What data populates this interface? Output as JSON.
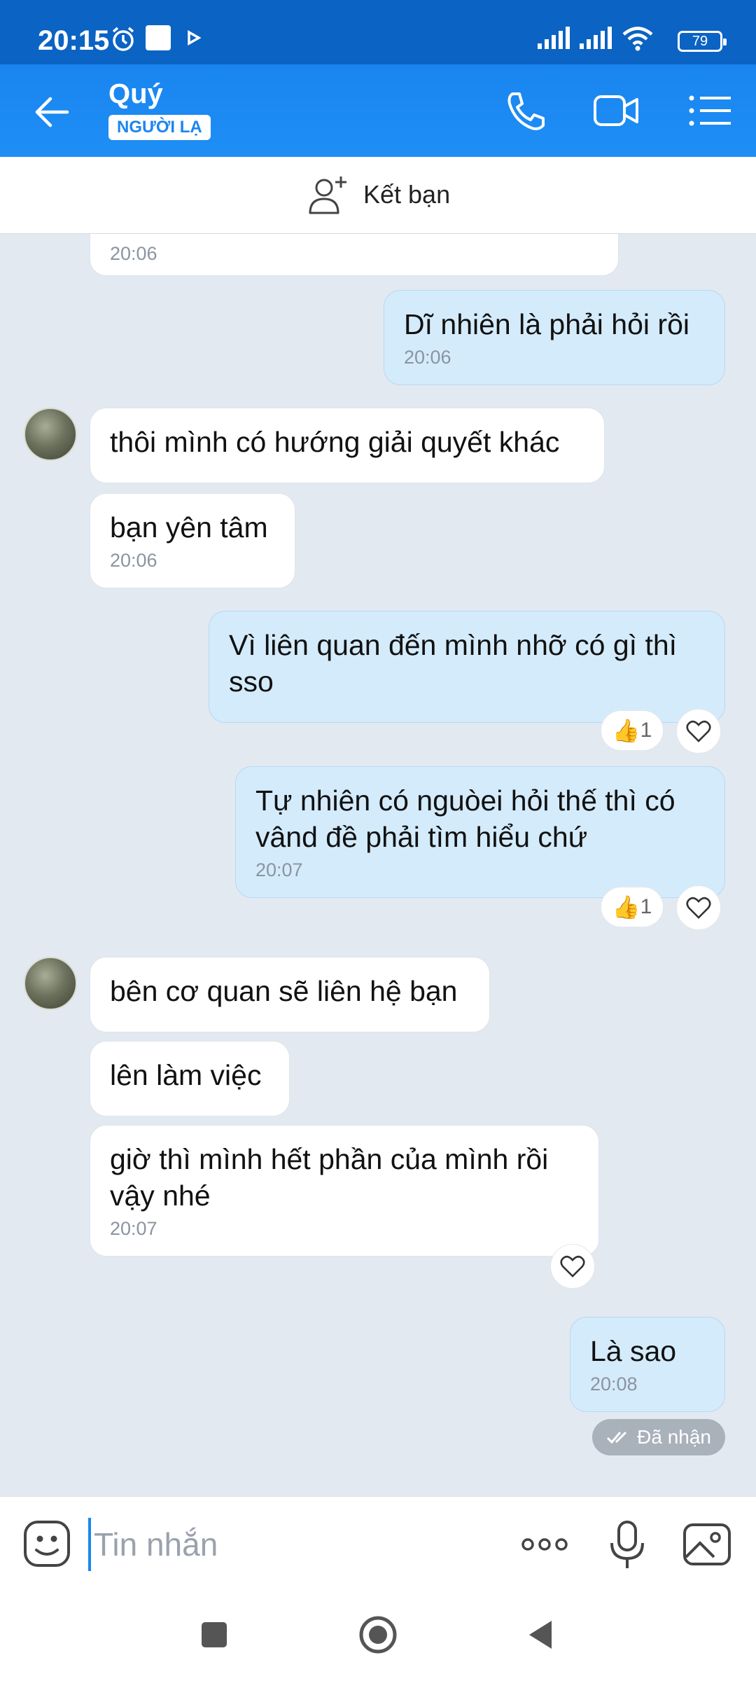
{
  "status": {
    "time": "20:15",
    "battery": "79"
  },
  "header": {
    "name": "Quý",
    "badge": "NGƯỜI LẠ"
  },
  "add_friend": {
    "label": "Kết bạn"
  },
  "messages": {
    "m0_time": "20:06",
    "m1_text": "Dĩ nhiên là phải hỏi rồi",
    "m1_time": "20:06",
    "m2_text": "thôi mình có hướng giải quyết khác",
    "m3_text": "bạn yên tâm",
    "m3_time": "20:06",
    "m4_text": "Vì liên quan đến mình nhỡ có gì thì sso",
    "m4_react": "1",
    "m5_text": "Tự nhiên có nguòei hỏi thế thì có vând đề phải tìm hiểu chứ",
    "m5_time": "20:07",
    "m5_react": "1",
    "m6_text": "bên cơ quan sẽ liên hệ bạn",
    "m7_text": "lên làm việc",
    "m8_text": "giờ thì mình hết phần của mình rồi vậy nhé",
    "m8_time": "20:07",
    "m9_text": "Là sao",
    "m9_time": "20:08",
    "seen_label": "Đã nhận"
  },
  "composer": {
    "placeholder": "Tin nhắn"
  },
  "colors": {
    "header_blue": "#1a86f0",
    "outgoing_bubble": "#d4ebfb",
    "chat_bg": "#e2e9f1"
  },
  "icons": [
    "alarm-icon",
    "play-icon",
    "signal-icon",
    "wifi-icon",
    "battery-icon",
    "back-arrow-icon",
    "phone-icon",
    "video-call-icon",
    "menu-icon",
    "add-friend-icon",
    "thumbs-up-icon",
    "heart-icon",
    "double-check-icon",
    "sticker-icon",
    "more-icon",
    "microphone-icon",
    "image-icon"
  ]
}
